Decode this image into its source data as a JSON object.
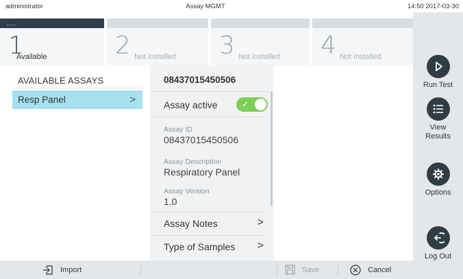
{
  "status": {
    "user": "administrator",
    "title": "Assay MGMT",
    "datetime": "14:50 2017-03-30"
  },
  "modules": [
    {
      "number": "1",
      "label": "Available",
      "active": true
    },
    {
      "number": "2",
      "label": "Not installed",
      "active": false
    },
    {
      "number": "3",
      "label": "Not installed",
      "active": false
    },
    {
      "number": "4",
      "label": "Not installed",
      "active": false
    }
  ],
  "sidebar": {
    "run_test": "Run Test",
    "view_results_line1": "View",
    "view_results_line2": "Results",
    "options": "Options",
    "log_out": "Log Out"
  },
  "available": {
    "header": "AVAILABLE ASSAYS",
    "items": [
      {
        "label": "Resp Panel"
      }
    ]
  },
  "detail": {
    "code": "08437015450506",
    "active_label": "Assay active",
    "active": true,
    "assay_id_label": "Assay ID",
    "assay_id": "08437015450506",
    "description_label": "Assay Description",
    "description": "Respiratory Panel",
    "version_label": "Assay Version",
    "version": "1.0",
    "notes_label": "Assay Notes",
    "samples_label": "Type of Samples"
  },
  "bottom": {
    "import": "Import",
    "save": "Save",
    "cancel": "Cancel"
  },
  "colors": {
    "accent": "#a7e0ef",
    "toggle_on": "#7ed056",
    "dark": "#2f3d47"
  }
}
